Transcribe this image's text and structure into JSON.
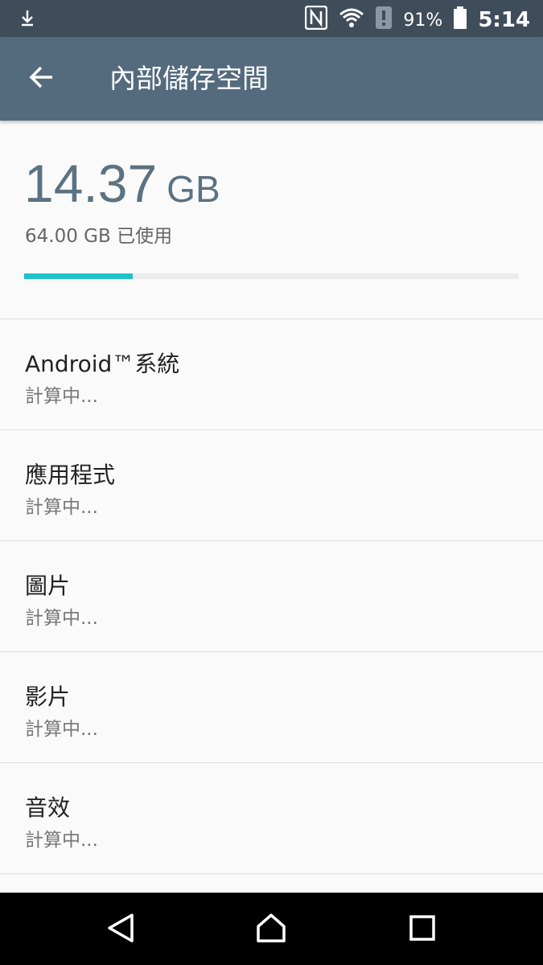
{
  "status_bar": {
    "battery": "91%",
    "time": "5:14",
    "icons": [
      "download-icon",
      "nfc-icon",
      "wifi-icon",
      "alert-icon",
      "battery-icon"
    ]
  },
  "toolbar": {
    "title": "內部儲存空間",
    "back_icon": "arrow-left-icon"
  },
  "storage": {
    "free_value": "14.37",
    "free_unit": "GB",
    "used_text": "64.00 GB 已使用",
    "used_fraction": 0.22
  },
  "items": [
    {
      "title": "Android™系統",
      "status": "計算中..."
    },
    {
      "title": "應用程式",
      "status": "計算中..."
    },
    {
      "title": "圖片",
      "status": "計算中..."
    },
    {
      "title": "影片",
      "status": "計算中..."
    },
    {
      "title": "音效",
      "status": "計算中..."
    }
  ],
  "nav_bar": {
    "icons": [
      "back-triangle-icon",
      "home-icon",
      "recents-icon"
    ]
  },
  "colors": {
    "status_bar": "#3f4d5a",
    "toolbar": "#546b7e",
    "accent": "#20c2c9",
    "number": "#5b7282"
  }
}
